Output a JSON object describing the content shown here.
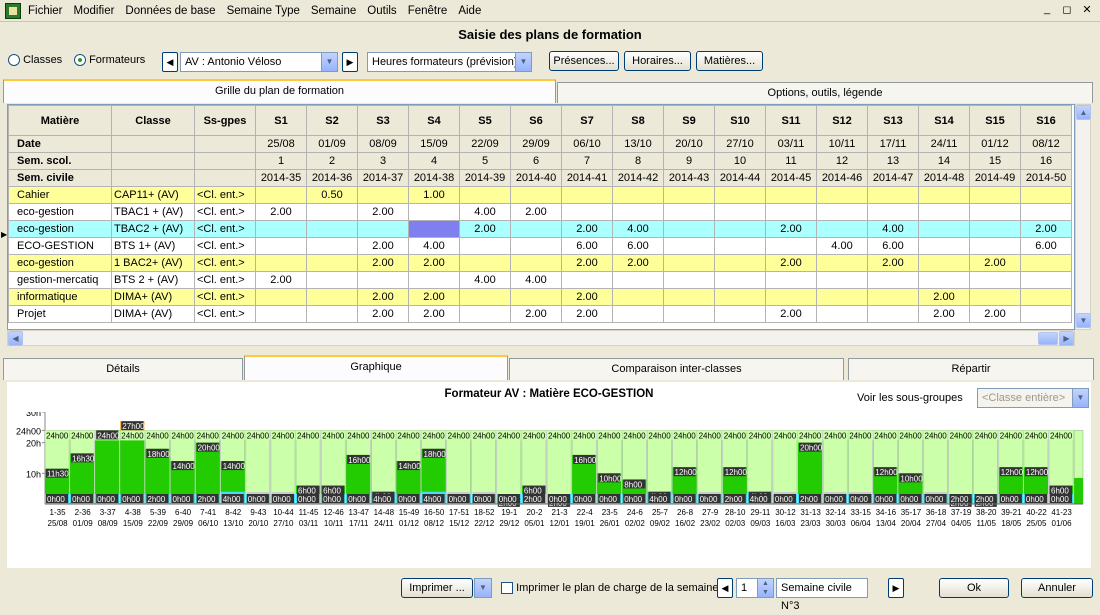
{
  "menu": [
    "Fichier",
    "Modifier",
    "Données de base",
    "Semaine Type",
    "Semaine",
    "Outils",
    "Fenêtre",
    "Aide"
  ],
  "window_controls": [
    "_",
    "◻",
    "✕"
  ],
  "title": "Saisie des plans de formation",
  "toolbar": {
    "radio_classes": "Classes",
    "radio_formateurs": "Formateurs",
    "formateur_value": "AV : Antonio Véloso",
    "heures_value": "Heures formateurs (prévision)",
    "presences": "Présences...",
    "horaires": "Horaires...",
    "matieres": "Matières..."
  },
  "top_tabs": [
    "Grille du plan de formation",
    "Options, outils, légende"
  ],
  "grid": {
    "headers": [
      "Matière",
      "Classe",
      "Ss-gpes",
      "S1",
      "S2",
      "S3",
      "S4",
      "S5",
      "S6",
      "S7",
      "S8",
      "S9",
      "S10",
      "S11",
      "S12",
      "S13",
      "S14",
      "S15",
      "S16"
    ],
    "info_rows": [
      {
        "label": "Date",
        "values": [
          "25/08",
          "01/09",
          "08/09",
          "15/09",
          "22/09",
          "29/09",
          "06/10",
          "13/10",
          "20/10",
          "27/10",
          "03/11",
          "10/11",
          "17/11",
          "24/11",
          "01/12",
          "08/12"
        ]
      },
      {
        "label": "Sem. scol.",
        "values": [
          "1",
          "2",
          "3",
          "4",
          "5",
          "6",
          "7",
          "8",
          "9",
          "10",
          "11",
          "12",
          "13",
          "14",
          "15",
          "16"
        ]
      },
      {
        "label": "Sem. civile",
        "values": [
          "2014-35",
          "2014-36",
          "2014-37",
          "2014-38",
          "2014-39",
          "2014-40",
          "2014-41",
          "2014-42",
          "2014-43",
          "2014-44",
          "2014-45",
          "2014-46",
          "2014-47",
          "2014-48",
          "2014-49",
          "2014-50"
        ]
      }
    ],
    "rows": [
      {
        "matiere": "Cahier",
        "classe": "CAP11+ (AV)",
        "ssg": "<Cl. ent.>",
        "color": "ylw",
        "values": [
          "",
          "0.50",
          "",
          "1.00",
          "",
          "",
          "",
          "",
          "",
          "",
          "",
          "",
          "",
          "",
          "",
          ""
        ]
      },
      {
        "matiere": "eco-gestion",
        "classe": "TBAC1 + (AV)",
        "ssg": "<Cl. ent.>",
        "color": "white",
        "values": [
          "2.00",
          "",
          "2.00",
          "",
          "4.00",
          "2.00",
          "",
          "",
          "",
          "",
          "",
          "",
          "",
          "",
          "",
          ""
        ]
      },
      {
        "matiere": "eco-gestion",
        "classe": "TBAC2 + (AV)",
        "ssg": "<Cl. ent.>",
        "color": "cyan",
        "current": true,
        "values": [
          "",
          "",
          "",
          "",
          "2.00",
          "",
          "2.00",
          "4.00",
          "",
          "",
          "2.00",
          "",
          "4.00",
          "",
          "",
          "2.00"
        ]
      },
      {
        "matiere": "ECO-GESTION",
        "classe": "BTS 1+ (AV)",
        "ssg": "<Cl. ent.>",
        "color": "white",
        "values": [
          "",
          "",
          "2.00",
          "4.00",
          "",
          "",
          "6.00",
          "6.00",
          "",
          "",
          "",
          "4.00",
          "6.00",
          "",
          "",
          "6.00"
        ]
      },
      {
        "matiere": "eco-gestion",
        "classe": "1 BAC2+ (AV)",
        "ssg": "<Cl. ent.>",
        "color": "ylw",
        "values": [
          "",
          "",
          "2.00",
          "2.00",
          "",
          "",
          "2.00",
          "2.00",
          "",
          "",
          "2.00",
          "",
          "2.00",
          "",
          "2.00",
          ""
        ]
      },
      {
        "matiere": "gestion-mercatiq",
        "classe": "BTS 2 + (AV)",
        "ssg": "<Cl. ent.>",
        "color": "white",
        "values": [
          "2.00",
          "",
          "",
          "",
          "4.00",
          "4.00",
          "",
          "",
          "",
          "",
          "",
          "",
          "",
          "",
          "",
          ""
        ]
      },
      {
        "matiere": "informatique",
        "classe": "DIMA+ (AV)",
        "ssg": "<Cl. ent.>",
        "color": "ylw",
        "values": [
          "",
          "",
          "2.00",
          "2.00",
          "",
          "",
          "2.00",
          "",
          "",
          "",
          "",
          "",
          "",
          "2.00",
          "",
          ""
        ]
      },
      {
        "matiere": "Projet",
        "classe": "DIMA+ (AV)",
        "ssg": "<Cl. ent.>",
        "color": "white",
        "values": [
          "",
          "",
          "2.00",
          "2.00",
          "",
          "2.00",
          "2.00",
          "",
          "",
          "",
          "2.00",
          "",
          "",
          "2.00",
          "2.00",
          ""
        ]
      }
    ]
  },
  "bottom_tabs": [
    "Détails",
    "Graphique",
    "Comparaison inter-classes",
    "Répartir"
  ],
  "chart_title": "Formateur AV : Matière ECO-GESTION",
  "subgroups": {
    "label": "Voir les sous-groupes",
    "value": "<Classe entière>"
  },
  "chart_data": {
    "type": "bar",
    "y_ticks": [
      "30h",
      "24h00",
      "20h",
      "10h"
    ],
    "categories": [
      "1-35 25/08",
      "2-36 01/09",
      "3-37 08/09",
      "4-38 15/09",
      "5-39 22/09",
      "6-40 29/09",
      "7-41 06/10",
      "8-42 13/10",
      "9-43 20/10",
      "10-44 27/10",
      "11-45 03/11",
      "12-46 10/11",
      "13-47 17/11",
      "14-48 24/11",
      "15-49 01/12",
      "16-50 08/12",
      "17-51 15/12",
      "18-52 22/12",
      "19-1 29/12",
      "20-2 05/01",
      "21-3 12/01",
      "22-4 19/01",
      "23-5 26/01",
      "24-6 02/02",
      "25-7 09/02",
      "26-8 16/02",
      "27-9 23/02",
      "28-10 02/03",
      "29-11 09/03",
      "30-12 16/03",
      "31-13 23/03",
      "32-14 30/03",
      "33-15 06/04",
      "34-16 13/04",
      "35-17 20/04",
      "36-18 27/04",
      "37-19 04/05",
      "38-20 11/05",
      "39-21 18/05",
      "40-22 25/05",
      "41-23 01/06"
    ],
    "capacity": "24h00",
    "planned_labels": [
      "11h30",
      "16h30",
      "24h00",
      "27h00",
      "18h00",
      "14h00",
      "20h00",
      "14h00",
      "0h00",
      "0h00",
      "6h00",
      "6h00",
      "16h00",
      "4h00",
      "14h00",
      "18h00",
      "0h00",
      "0h00",
      "2h00",
      "6h00",
      "2h00",
      "16h00",
      "10h00",
      "8h00",
      "4h00",
      "12h00",
      "0h00",
      "12h00",
      "4h00",
      "0h00",
      "20h00",
      "0h00",
      "0h00",
      "12h00",
      "10h00",
      "0h00",
      "2h00",
      "2h00",
      "12h00",
      "12h00",
      "6h00"
    ],
    "planned_hours": [
      11.5,
      16.5,
      24,
      27,
      18,
      14,
      20,
      14,
      0,
      0,
      6,
      6,
      16,
      4,
      14,
      18,
      0,
      0,
      2,
      6,
      2,
      16,
      10,
      8,
      4,
      12,
      0,
      12,
      4,
      0,
      20,
      0,
      0,
      12,
      10,
      0,
      2,
      2,
      12,
      12,
      6
    ],
    "current_labels": [
      "0h00",
      "0h00",
      "0h00",
      "0h00",
      "2h00",
      "0h00",
      "2h00",
      "4h00",
      "0h00",
      "0h00",
      "0h00",
      "0h00",
      "0h00",
      "4h00",
      "0h00",
      "4h00",
      "0h00",
      "0h00",
      "0h00",
      "2h00",
      "0h00",
      "0h00",
      "0h00",
      "0h00",
      "4h00",
      "0h00",
      "0h00",
      "2h00",
      "4h00",
      "0h00",
      "2h00",
      "0h00",
      "0h00",
      "0h00",
      "0h00",
      "0h00",
      "2h00",
      "2h00",
      "0h00",
      "0h00",
      "0h00"
    ],
    "current_hours": [
      0,
      0,
      0,
      0,
      2,
      0,
      2,
      4,
      0,
      0,
      0,
      0,
      0,
      4,
      0,
      4,
      0,
      0,
      0,
      2,
      0,
      0,
      0,
      0,
      4,
      0,
      0,
      2,
      4,
      0,
      2,
      0,
      0,
      0,
      0,
      0,
      2,
      2,
      0,
      0,
      0
    ],
    "colors": {
      "capacity": "#ccffaa",
      "planned": "#22cc00",
      "over": "#ff9900",
      "current": "#44ddff",
      "label_bg": "#333333"
    }
  },
  "bottom": {
    "print_btn": "Imprimer ...",
    "print_check": "Imprimer le plan de charge de la semaine",
    "week_value": "1",
    "week_type": "Semaine civile N°3",
    "ok": "Ok",
    "cancel": "Annuler"
  }
}
